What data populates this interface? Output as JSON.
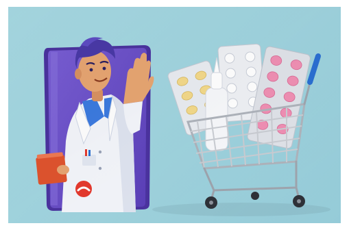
{
  "colors": {
    "background": "#a2d6e1",
    "phone": "#6a4fc4",
    "phone_edge": "#4b33a0",
    "doctor_coat": "#f4f6fb",
    "doctor_hair": "#4a3aa8",
    "skin": "#e8a672",
    "folder": "#e0542e",
    "end_call": "#e5392d",
    "cart_metal": "#c9ccd2",
    "cart_handle": "#2a6fd1",
    "pill_pink": "#ef8fb3",
    "pill_yellow": "#f3d98a",
    "blister_silver": "#dfe2e8"
  },
  "icons": {
    "end_call": "phone-hangup-icon"
  }
}
